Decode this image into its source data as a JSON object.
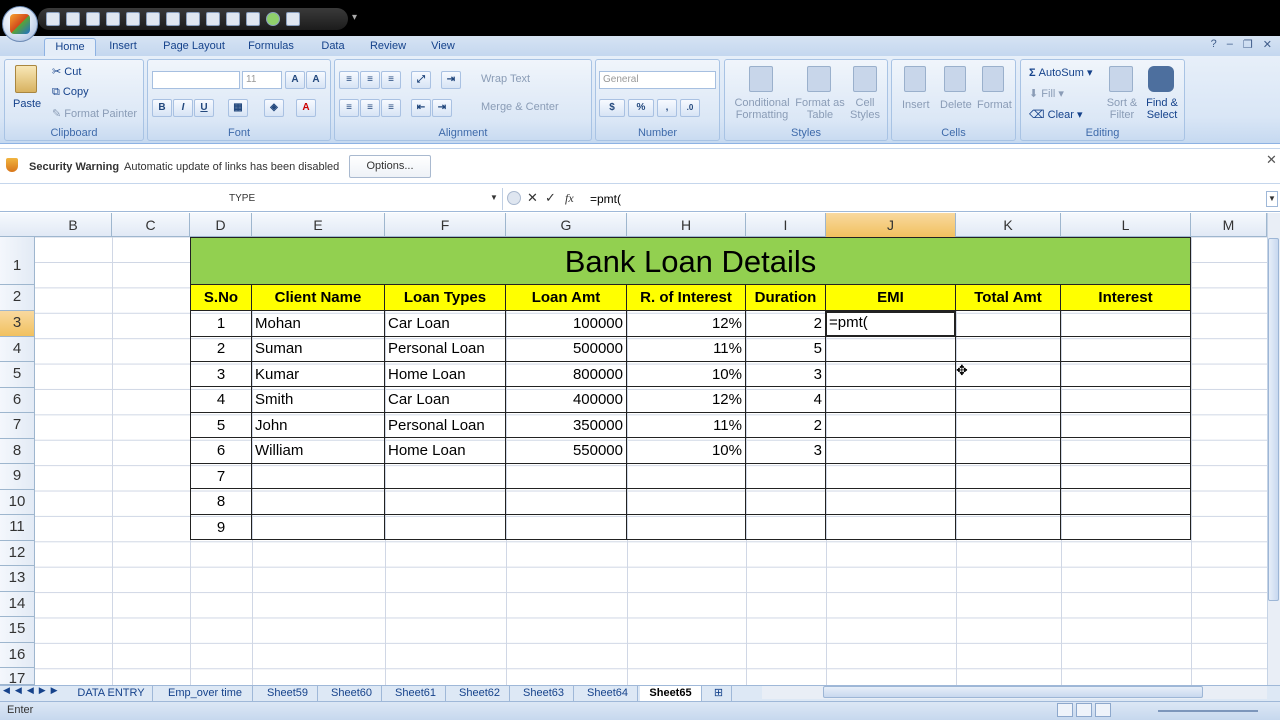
{
  "window": {
    "ribbon_tabs": [
      "Home",
      "Insert",
      "Page Layout",
      "Formulas",
      "Data",
      "Review",
      "View"
    ],
    "active_tab": "Home"
  },
  "ribbon": {
    "clipboard": {
      "paste": "Paste",
      "cut": "Cut",
      "copy": "Copy",
      "format_painter": "Format Painter",
      "label": "Clipboard"
    },
    "font": {
      "font_name": "",
      "font_size": "11",
      "bold": "B",
      "italic": "I",
      "underline": "U",
      "label": "Font"
    },
    "alignment": {
      "wrap_text": "Wrap Text",
      "merge_center": "Merge & Center",
      "label": "Alignment"
    },
    "number": {
      "format": "General",
      "currency": "$",
      "percent": "%",
      "comma": ",",
      "label": "Number"
    },
    "styles": {
      "conditional": "Conditional Formatting",
      "format_table": "Format as Table",
      "cell_styles": "Cell Styles",
      "label": "Styles"
    },
    "cells": {
      "insert": "Insert",
      "delete": "Delete",
      "format": "Format",
      "label": "Cells"
    },
    "editing": {
      "autosum": "AutoSum",
      "fill": "Fill",
      "clear": "Clear",
      "sort_filter": "Sort & Filter",
      "find_select": "Find & Select",
      "label": "Editing"
    }
  },
  "security_bar": {
    "title": "Security Warning",
    "message": "Automatic update of links has been disabled",
    "options": "Options..."
  },
  "formula_bar": {
    "name_box": "TYPE",
    "formula": "=pmt("
  },
  "columns": [
    "B",
    "C",
    "D",
    "E",
    "F",
    "G",
    "H",
    "I",
    "J",
    "K",
    "L",
    "M"
  ],
  "selected_column": "J",
  "rows": [
    "1",
    "2",
    "3",
    "4",
    "5",
    "6",
    "7",
    "8",
    "9",
    "10",
    "11",
    "12",
    "13",
    "14",
    "15",
    "16",
    "17"
  ],
  "selected_row": "3",
  "sheet": {
    "title": "Bank Loan Details",
    "headers": [
      "S.No",
      "Client Name",
      "Loan Types",
      "Loan Amt",
      "R. of Interest",
      "Duration",
      "EMI",
      "Total Amt",
      "Interest"
    ],
    "data_rows": [
      [
        "1",
        "Mohan",
        "Car Loan",
        "100000",
        "12%",
        "2"
      ],
      [
        "2",
        "Suman",
        "Personal Loan",
        "500000",
        "11%",
        "5"
      ],
      [
        "3",
        "Kumar",
        "Home Loan",
        "800000",
        "10%",
        "3"
      ],
      [
        "4",
        "Smith",
        "Car Loan",
        "400000",
        "12%",
        "4"
      ],
      [
        "5",
        "John",
        "Personal Loan",
        "350000",
        "11%",
        "2"
      ],
      [
        "6",
        "William",
        "Home Loan",
        "550000",
        "10%",
        "3"
      ],
      [
        "7",
        "",
        "",
        "",
        "",
        ""
      ],
      [
        "8",
        "",
        "",
        "",
        "",
        ""
      ],
      [
        "9",
        "",
        "",
        "",
        "",
        ""
      ]
    ],
    "active_cell_text": "=pmt("
  },
  "sheet_tabs": [
    "DATA ENTRY",
    "Emp_over time",
    "Sheet59",
    "Sheet60",
    "Sheet61",
    "Sheet62",
    "Sheet63",
    "Sheet64",
    "Sheet65"
  ],
  "active_sheet": "Sheet65",
  "status": {
    "mode": "Enter"
  }
}
